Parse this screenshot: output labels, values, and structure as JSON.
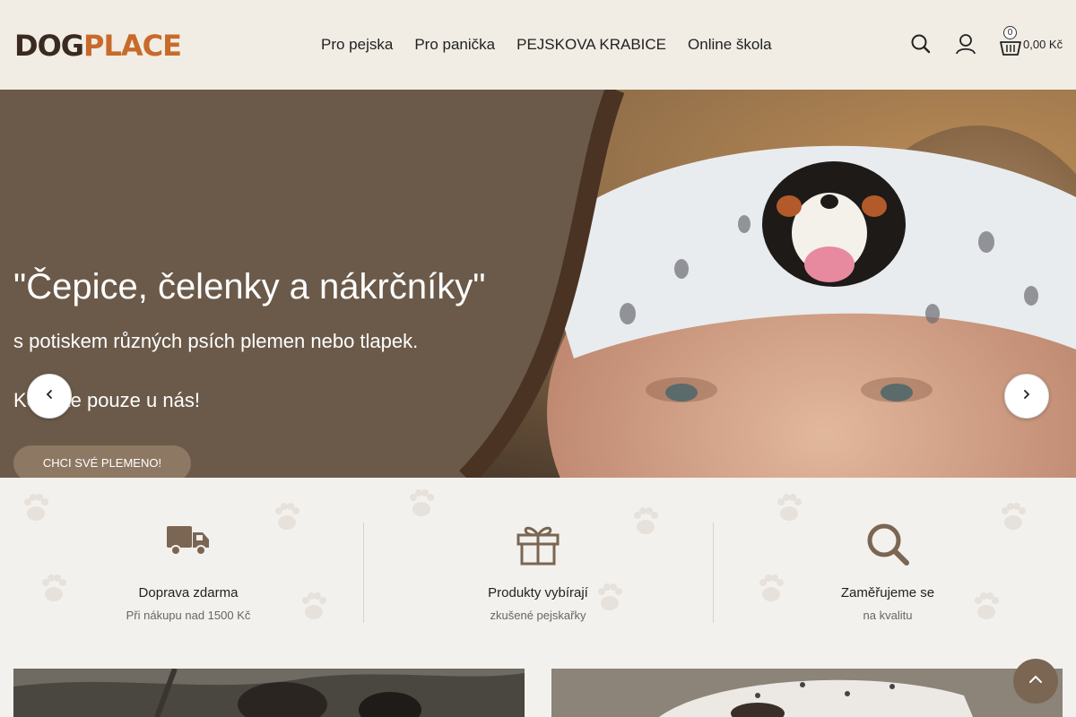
{
  "header": {
    "logo_dog": "DOG",
    "logo_place": "PLACE",
    "nav": [
      "Pro pejska",
      "Pro panička",
      "PEJSKOVA KRABICE",
      "Online škola"
    ],
    "cart_count": "0",
    "cart_total": "0,00 Kč",
    "icons": [
      "search-icon",
      "user-icon",
      "basket-icon"
    ]
  },
  "hero": {
    "title": "\"Čepice, čelenky a nákrčníky\"",
    "subtitle": "s potiskem různých psích plemen nebo tlapek.",
    "subtitle2": "Koupíte pouze u nás!",
    "cta": "CHCI SVÉ PLEMENO!",
    "icons": [
      "chevron-left-icon",
      "chevron-right-icon"
    ]
  },
  "features": [
    {
      "icon": "truck-icon",
      "title": "Doprava zdarma",
      "subtitle": "Při nákupu nad 1500 Kč"
    },
    {
      "icon": "gift-icon",
      "title": "Produkty vybírají",
      "subtitle": "zkušené pejskařky"
    },
    {
      "icon": "search-icon",
      "title": "Zaměřujeme se",
      "subtitle": "na kvalitu"
    }
  ],
  "colors": {
    "header_bg": "#f1ede4",
    "hero_overlay": "#6b5a49",
    "accent_brown": "#8d7863",
    "logo_orange": "#c86a2a",
    "icon_brown": "#7a6652"
  }
}
